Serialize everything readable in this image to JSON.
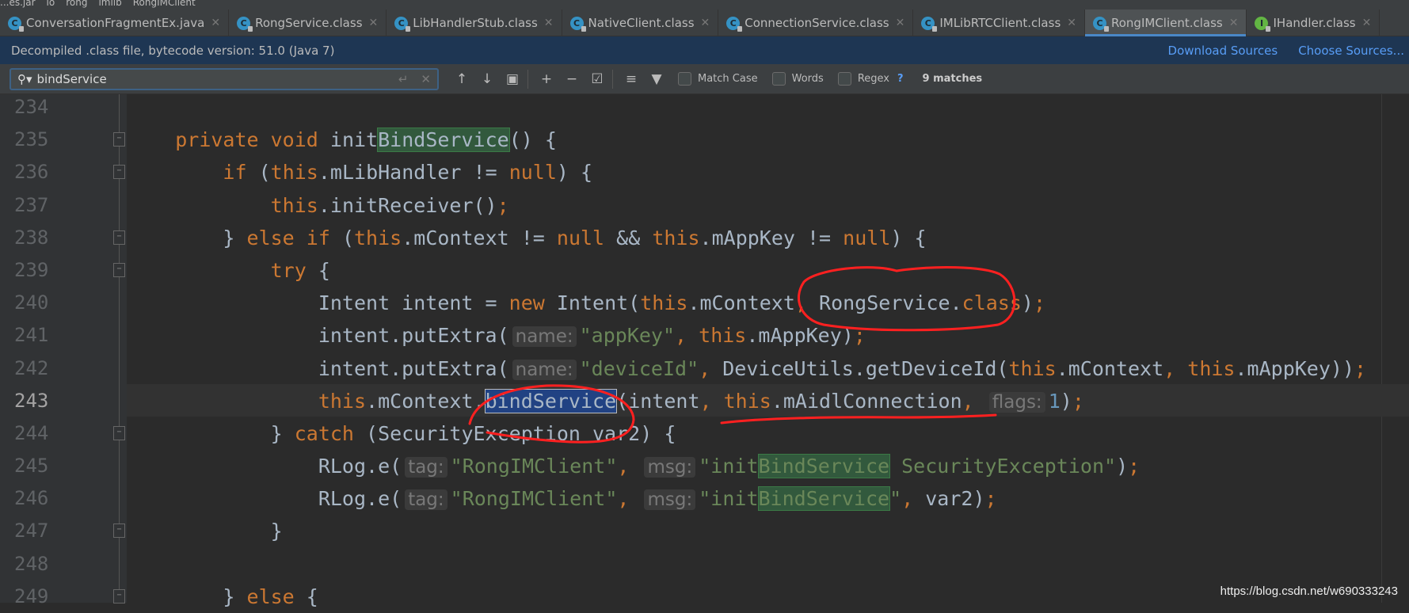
{
  "breadcrumb": [
    "...es.jar",
    "io",
    "rong",
    "imlib",
    "RongIMClient"
  ],
  "tabs": [
    {
      "label": "ConversationFragmentEx.java",
      "icon": "C",
      "active": false
    },
    {
      "label": "RongService.class",
      "icon": "C",
      "active": false
    },
    {
      "label": "LibHandlerStub.class",
      "icon": "C",
      "active": false
    },
    {
      "label": "NativeClient.class",
      "icon": "C",
      "active": false
    },
    {
      "label": "ConnectionService.class",
      "icon": "C",
      "active": false
    },
    {
      "label": "IMLibRTCClient.class",
      "icon": "C",
      "active": false
    },
    {
      "label": "RongIMClient.class",
      "icon": "C",
      "active": true
    },
    {
      "label": "IHandler.class",
      "icon": "I",
      "active": false
    }
  ],
  "banner": {
    "text": "Decompiled .class file, bytecode version: 51.0 (Java 7)",
    "download": "Download Sources",
    "choose": "Choose Sources..."
  },
  "search": {
    "value": "bindService",
    "match_case": "Match Case",
    "words": "Words",
    "regex": "Regex",
    "help": "?",
    "matches": "9 matches"
  },
  "colors": {
    "keyword": "#cc7832",
    "string": "#6a8759",
    "number": "#6897bb",
    "text": "#a9b7c6",
    "annotation": "#ff2020"
  },
  "code": {
    "current_line": 243,
    "lines": [
      {
        "n": 234,
        "t": []
      },
      {
        "n": 235,
        "fold": true,
        "t": [
          [
            "    ",
            ""
          ],
          [
            "private void ",
            "k"
          ],
          [
            "init",
            ""
          ],
          [
            "BindService",
            "m"
          ],
          [
            "() {",
            ""
          ]
        ]
      },
      {
        "n": 236,
        "fold": true,
        "t": [
          [
            "        ",
            ""
          ],
          [
            "if ",
            "k"
          ],
          [
            "(",
            ""
          ],
          [
            "this",
            "k"
          ],
          [
            ".mLibHandler != ",
            ""
          ],
          [
            "null",
            "k"
          ],
          [
            ") {",
            ""
          ]
        ]
      },
      {
        "n": 237,
        "t": [
          [
            "            ",
            ""
          ],
          [
            "this",
            "k"
          ],
          [
            ".initReceiver()",
            ""
          ],
          [
            ";",
            "k"
          ]
        ]
      },
      {
        "n": 238,
        "fold": true,
        "t": [
          [
            "        } ",
            ""
          ],
          [
            "else if ",
            "k"
          ],
          [
            "(",
            ""
          ],
          [
            "this",
            "k"
          ],
          [
            ".mContext != ",
            ""
          ],
          [
            "null",
            "k"
          ],
          [
            " && ",
            ""
          ],
          [
            "this",
            "k"
          ],
          [
            ".mAppKey != ",
            ""
          ],
          [
            "null",
            "k"
          ],
          [
            ") {",
            ""
          ]
        ]
      },
      {
        "n": 239,
        "fold": true,
        "t": [
          [
            "            ",
            ""
          ],
          [
            "try ",
            "k"
          ],
          [
            "{",
            ""
          ]
        ]
      },
      {
        "n": 240,
        "t": [
          [
            "                Intent intent = ",
            ""
          ],
          [
            "new ",
            "k"
          ],
          [
            "Intent(",
            ""
          ],
          [
            "this",
            "k"
          ],
          [
            ".mContext",
            ""
          ],
          [
            ", ",
            "k"
          ],
          [
            "RongService.",
            ""
          ],
          [
            "class",
            "k"
          ],
          [
            ")",
            ""
          ],
          [
            ";",
            "k"
          ]
        ]
      },
      {
        "n": 241,
        "t": [
          [
            "                intent.putExtra(",
            ""
          ],
          [
            "name:",
            "h"
          ],
          [
            "\"appKey\"",
            "s"
          ],
          [
            ", ",
            "k"
          ],
          [
            "this",
            "k"
          ],
          [
            ".mAppKey)",
            ""
          ],
          [
            ";",
            "k"
          ]
        ]
      },
      {
        "n": 242,
        "t": [
          [
            "                intent.putExtra(",
            ""
          ],
          [
            "name:",
            "h"
          ],
          [
            "\"deviceId\"",
            "s"
          ],
          [
            ", ",
            "k"
          ],
          [
            "DeviceUtils.getDeviceId(",
            ""
          ],
          [
            "this",
            "k"
          ],
          [
            ".mContext",
            ""
          ],
          [
            ", ",
            "k"
          ],
          [
            "this",
            "k"
          ],
          [
            ".mAppKey))",
            ""
          ],
          [
            ";",
            "k"
          ]
        ]
      },
      {
        "n": 243,
        "t": [
          [
            "                ",
            ""
          ],
          [
            "this",
            "k"
          ],
          [
            ".mContext.",
            ""
          ],
          [
            "bindService",
            "sel"
          ],
          [
            "(intent",
            ""
          ],
          [
            ", ",
            "k"
          ],
          [
            "this",
            "k"
          ],
          [
            ".mAidlConnection",
            ""
          ],
          [
            ", ",
            "k"
          ],
          [
            "flags:",
            "h"
          ],
          [
            "1",
            "n"
          ],
          [
            ")",
            ""
          ],
          [
            ";",
            "k"
          ]
        ]
      },
      {
        "n": 244,
        "fold": true,
        "t": [
          [
            "            } ",
            ""
          ],
          [
            "catch ",
            "k"
          ],
          [
            "(SecurityException var2) {",
            ""
          ]
        ]
      },
      {
        "n": 245,
        "t": [
          [
            "                RLog.e(",
            ""
          ],
          [
            "tag:",
            "h"
          ],
          [
            "\"RongIMClient\"",
            "s"
          ],
          [
            ", ",
            "k"
          ],
          [
            "msg:",
            "h"
          ],
          [
            "\"init",
            "s"
          ],
          [
            "BindService",
            "s m"
          ],
          [
            " SecurityException\"",
            "s"
          ],
          [
            ")",
            ""
          ],
          [
            ";",
            "k"
          ]
        ]
      },
      {
        "n": 246,
        "t": [
          [
            "                RLog.e(",
            ""
          ],
          [
            "tag:",
            "h"
          ],
          [
            "\"RongIMClient\"",
            "s"
          ],
          [
            ", ",
            "k"
          ],
          [
            "msg:",
            "h"
          ],
          [
            "\"init",
            "s"
          ],
          [
            "BindService",
            "s m"
          ],
          [
            "\"",
            "s"
          ],
          [
            ", ",
            "k"
          ],
          [
            "var2)",
            ""
          ],
          [
            ";",
            "k"
          ]
        ]
      },
      {
        "n": 247,
        "fold": true,
        "t": [
          [
            "            }",
            ""
          ]
        ]
      },
      {
        "n": 248,
        "t": []
      },
      {
        "n": 249,
        "fold": true,
        "t": [
          [
            "        } ",
            ""
          ],
          [
            "else ",
            "k"
          ],
          [
            "{",
            ""
          ]
        ]
      }
    ]
  },
  "watermark": "https://blog.csdn.net/w690333243"
}
